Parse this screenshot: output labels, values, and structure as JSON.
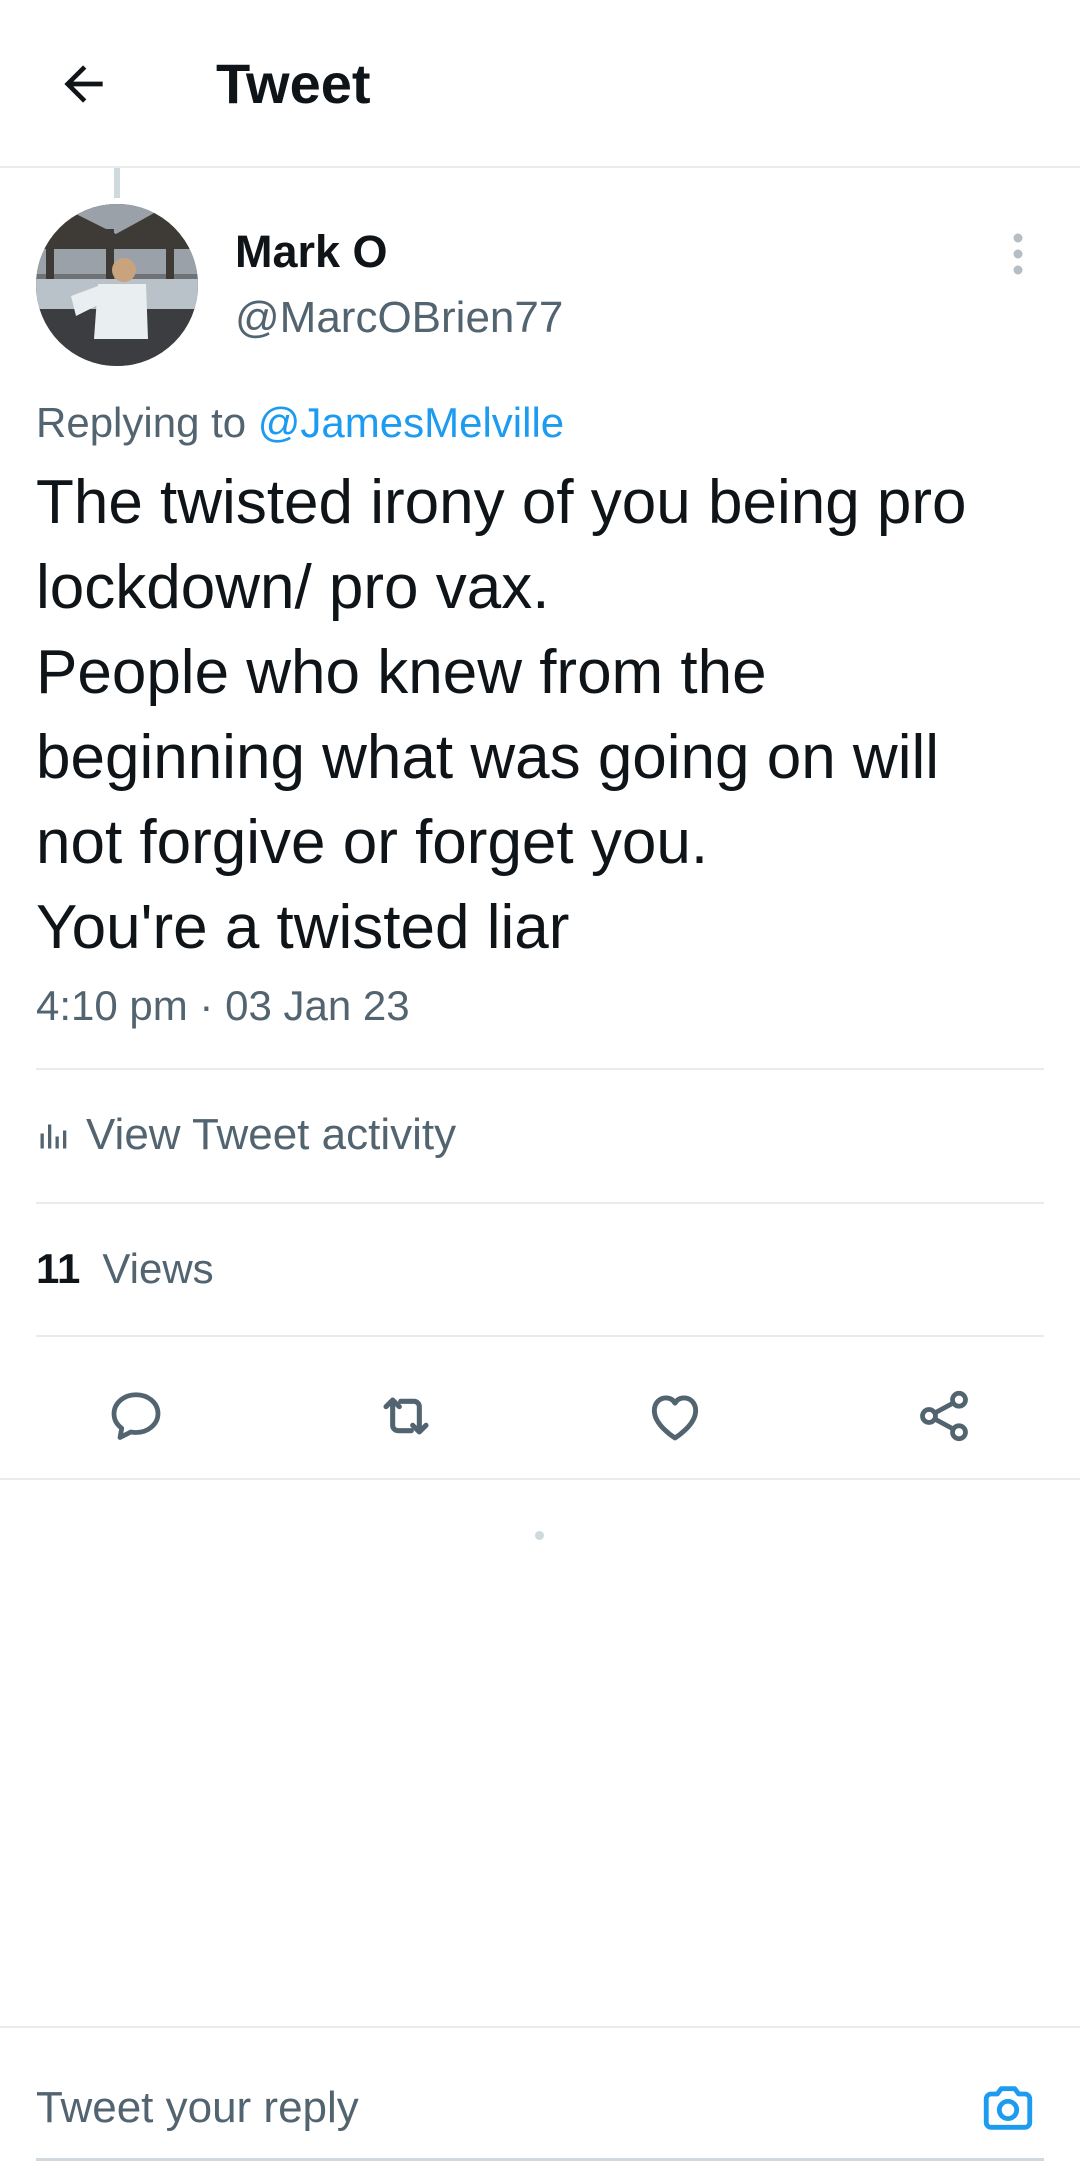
{
  "header": {
    "title": "Tweet",
    "back_icon": "arrow-left-icon"
  },
  "tweet": {
    "author": {
      "display_name": "Mark O",
      "handle": "@MarcOBrien77",
      "avatar_icon": "user-avatar-photo"
    },
    "replying_to_prefix": "Replying to",
    "replying_to_handle": "@JamesMelville",
    "text_lines": [
      "The twisted irony of you being pro",
      "lockdown/ pro vax.",
      "People who knew from the",
      "beginning what was going on will",
      "not forgive or forget you.",
      "You're a twisted liar"
    ],
    "timestamp": "4:10 pm · 03 Jan 23",
    "more_icon": "more-vertical-icon"
  },
  "activity": {
    "label": "View Tweet activity",
    "icon": "bar-chart-icon"
  },
  "views": {
    "count": "11",
    "label": "Views"
  },
  "actions": [
    {
      "name": "reply",
      "icon": "comment-icon"
    },
    {
      "name": "retweet",
      "icon": "retweet-icon"
    },
    {
      "name": "like",
      "icon": "heart-icon"
    },
    {
      "name": "share",
      "icon": "share-icon"
    }
  ],
  "reply_box": {
    "placeholder": "Tweet your reply",
    "value": "",
    "camera_icon": "camera-icon"
  },
  "colors": {
    "accent": "#1d9bf0",
    "text_primary": "#0f1419",
    "text_secondary": "#536471",
    "divider": "#e6ecf0"
  }
}
